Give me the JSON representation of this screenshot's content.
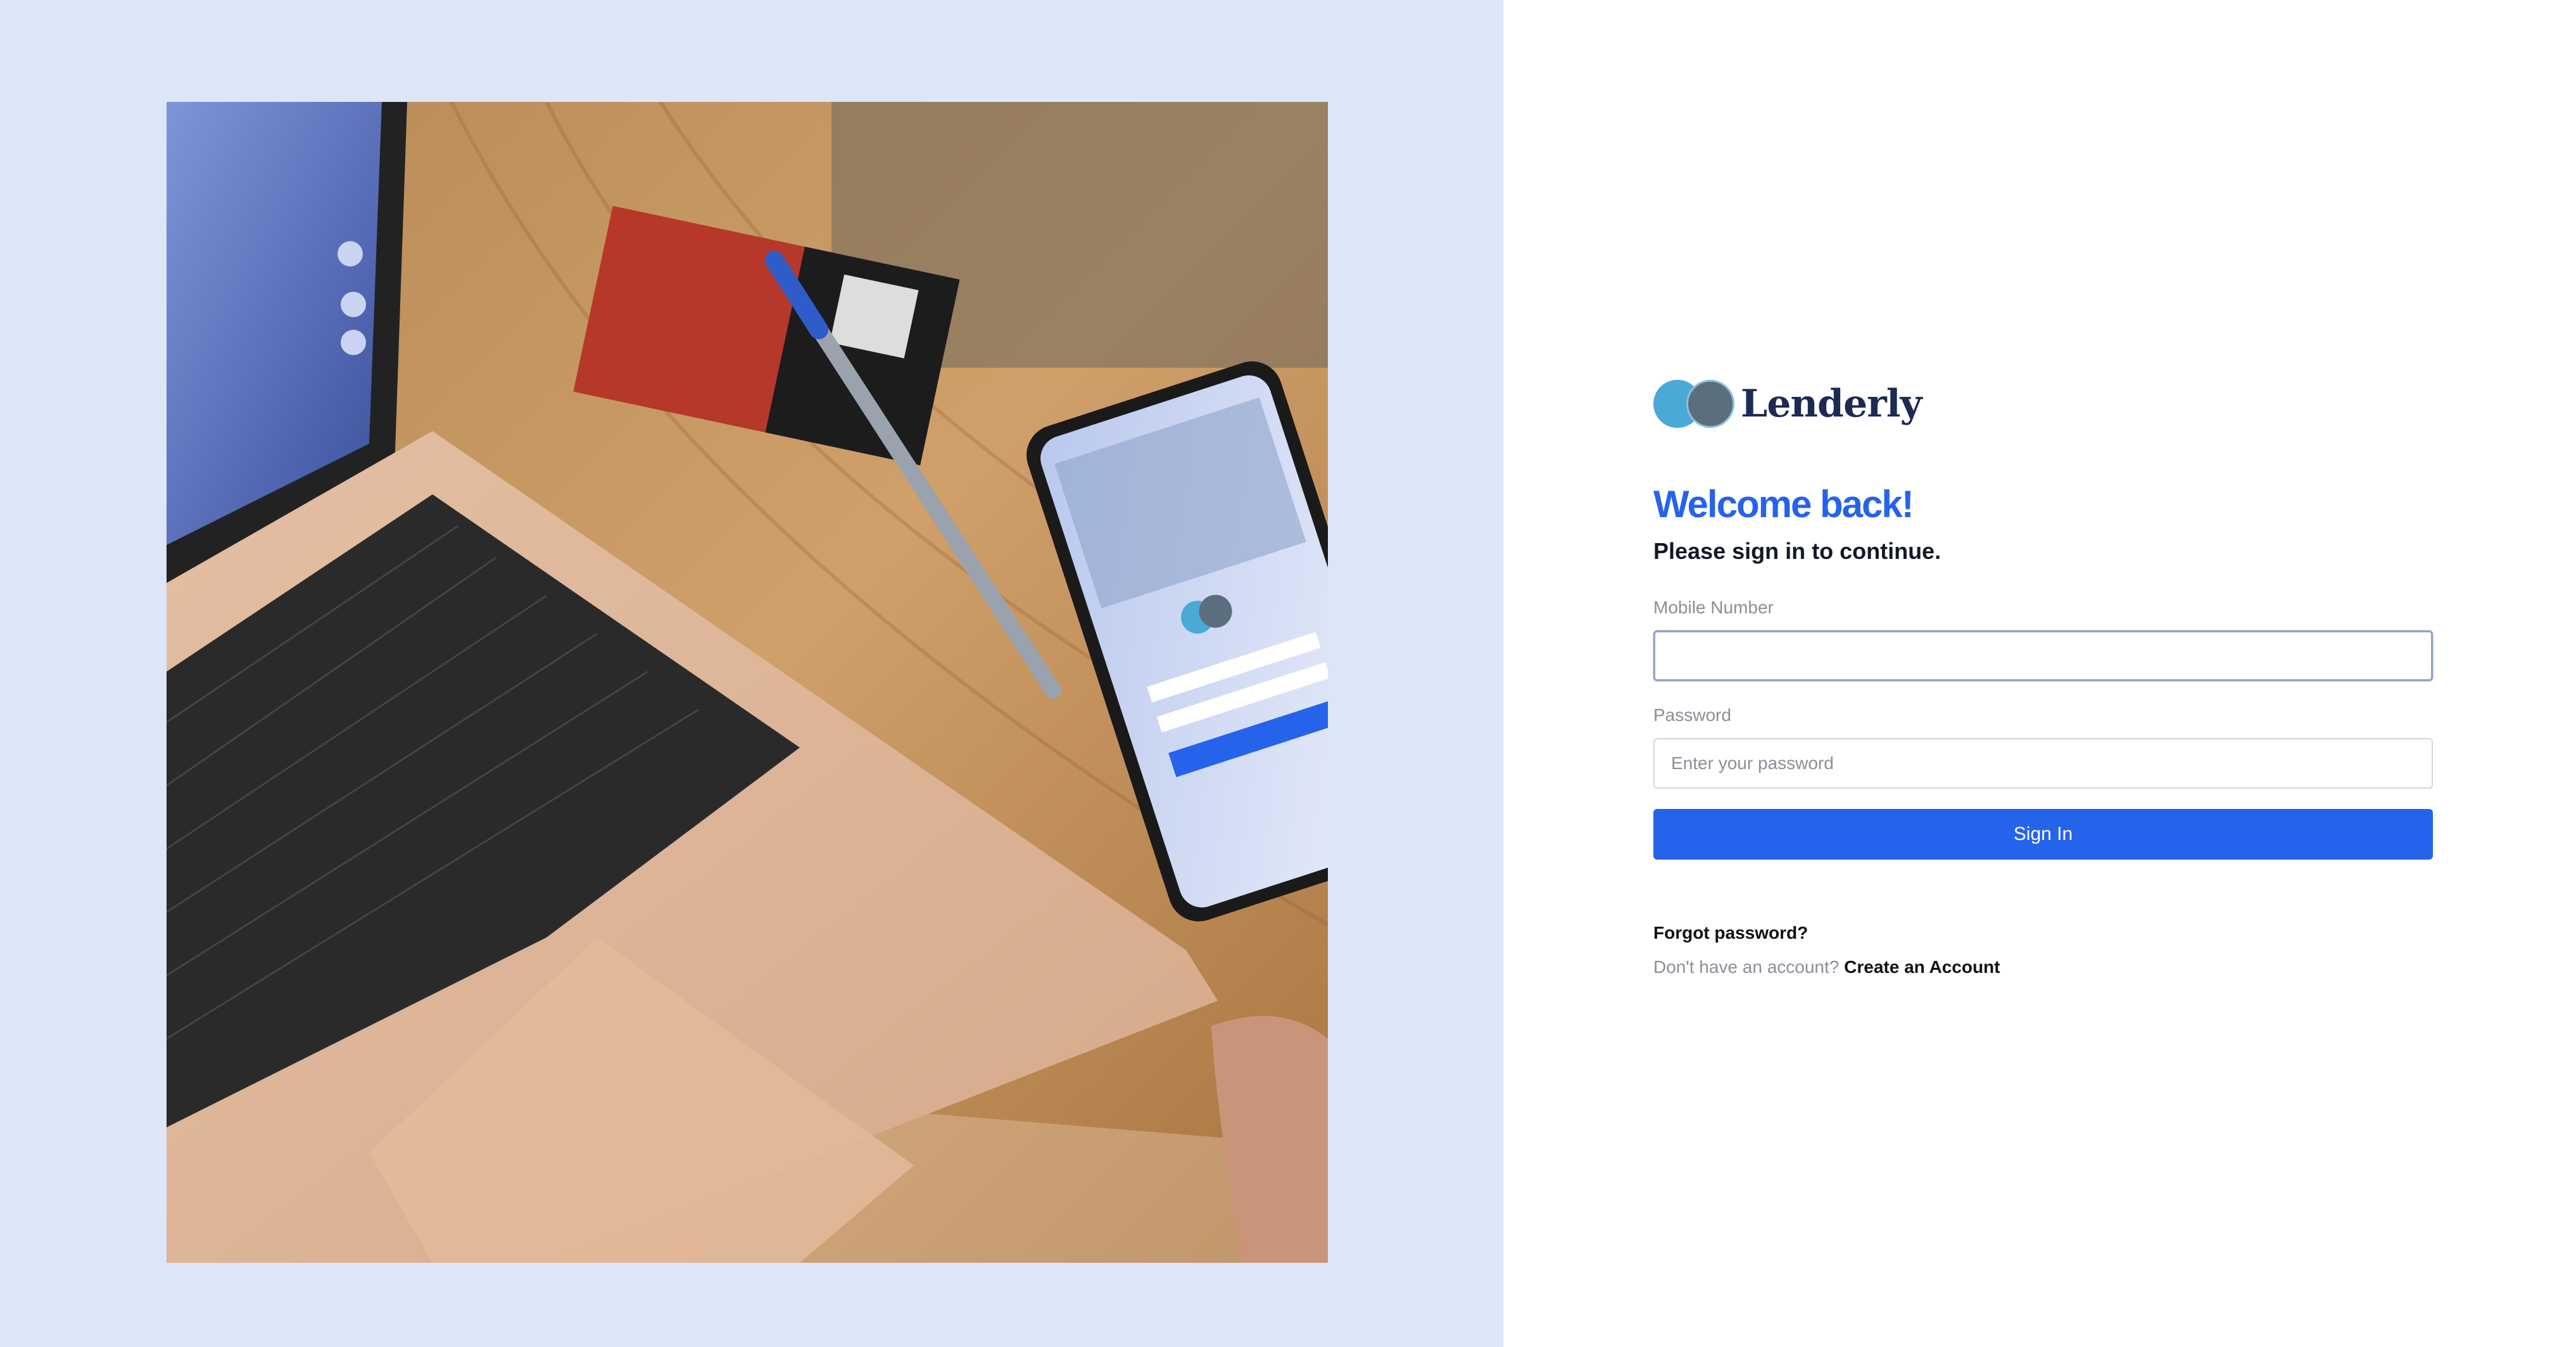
{
  "brand": {
    "name": "Lenderly",
    "colors": {
      "primary": "#2563eb",
      "left_bg": "#dce6f7",
      "logo_light": "#4aa9d6",
      "logo_dark": "#5a6e7d"
    }
  },
  "hero": {
    "icon": "laptop-phone-photo",
    "description_alt": "Laptop and phone on a wooden table"
  },
  "login": {
    "welcome": "Welcome back!",
    "subtitle": "Please sign in to continue.",
    "mobile": {
      "label": "Mobile Number",
      "value": "",
      "placeholder": ""
    },
    "password": {
      "label": "Password",
      "value": "",
      "placeholder": "Enter your password"
    },
    "sign_in_label": "Sign In",
    "forgot_label": "Forgot password?",
    "no_account_text": "Don't have an account?",
    "create_account_label": "Create an Account"
  }
}
